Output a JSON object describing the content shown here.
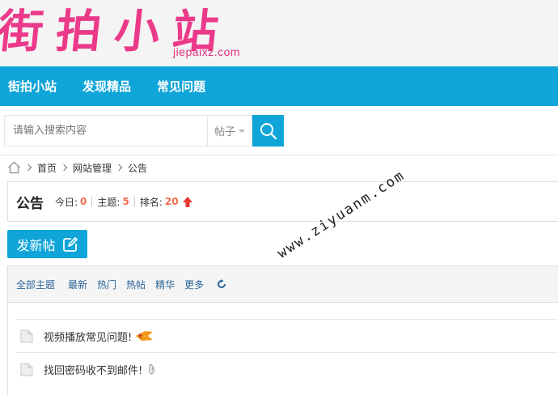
{
  "header": {
    "logo_title": "街拍小站",
    "logo_sub": "jiepaixz.com"
  },
  "nav": {
    "items": [
      {
        "label": "街拍小站"
      },
      {
        "label": "发现精品"
      },
      {
        "label": "常见问题"
      }
    ]
  },
  "search": {
    "placeholder": "请输入搜索内容",
    "type_label": "帖子",
    "button_icon": "search-icon"
  },
  "breadcrumb": {
    "home_icon": "home-icon",
    "items": [
      "首页",
      "网站管理",
      "公告"
    ]
  },
  "forum": {
    "name": "公告",
    "today_label": "今日:",
    "today_value": "0",
    "topics_label": "主题:",
    "topics_value": "5",
    "rank_label": "排名:",
    "rank_value": "20",
    "rank_icon": "rank-up-arrow-icon"
  },
  "new_post": {
    "label": "发新帖",
    "icon": "edit-icon"
  },
  "filters": {
    "items": [
      "全部主题",
      "最新",
      "热门",
      "热帖",
      "精华",
      "更多"
    ],
    "refresh_icon": "refresh-icon"
  },
  "threads": [
    {
      "title": "视频播放常见问题!",
      "badge_icon": "hot-icon"
    },
    {
      "title": "找回密码收不到邮件!",
      "badge_icon": "attachment-icon"
    }
  ],
  "watermark": "www.ziyuanm.com",
  "colors": {
    "brand_blue": "#10a5d9",
    "logo_pink": "#ec3a8a",
    "stat_orange": "#f26c4f",
    "link_blue": "#2a6496"
  }
}
